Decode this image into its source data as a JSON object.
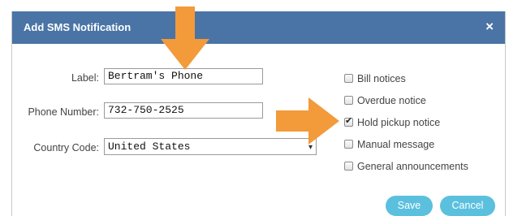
{
  "dialog": {
    "title": "Add SMS Notification",
    "close_icon": "×"
  },
  "form": {
    "label_label": "Label:",
    "label_value": "Bertram's Phone",
    "phone_label": "Phone Number:",
    "phone_value": "732-750-2525",
    "country_label": "Country Code:",
    "country_value": "United States"
  },
  "notifications": [
    {
      "label": "Bill notices",
      "checked": false
    },
    {
      "label": "Overdue notice",
      "checked": false
    },
    {
      "label": "Hold pickup notice",
      "checked": true
    },
    {
      "label": "Manual message",
      "checked": false
    },
    {
      "label": "General announcements",
      "checked": false
    }
  ],
  "buttons": {
    "save": "Save",
    "cancel": "Cancel"
  },
  "colors": {
    "titlebar": "#4a74a5",
    "button": "#5bc0de",
    "annotation_arrow": "#f39a3a"
  },
  "annotations": [
    "arrow-down-icon",
    "arrow-right-icon"
  ]
}
